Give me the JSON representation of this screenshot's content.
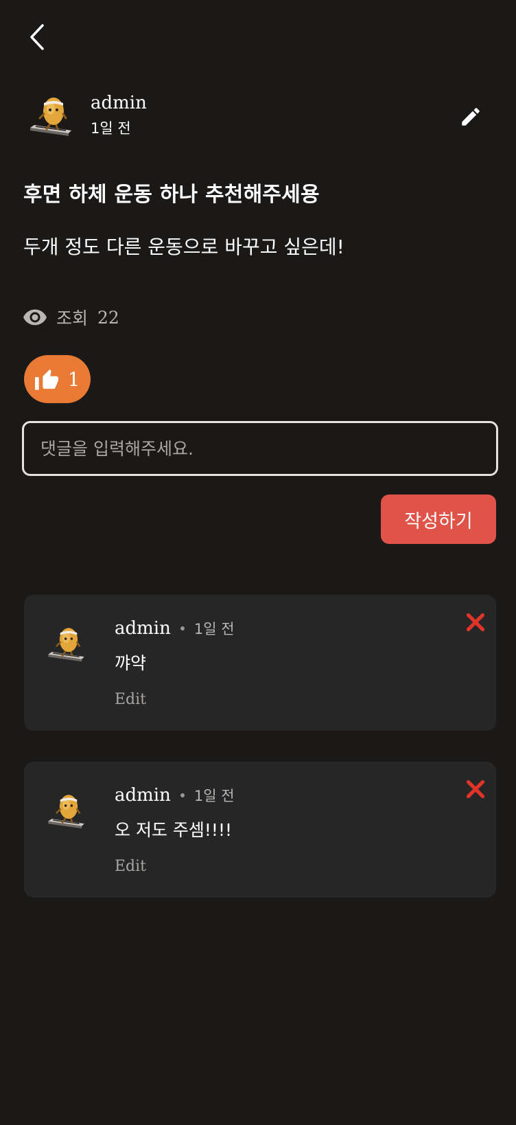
{
  "post": {
    "author": "admin",
    "time": "1일 전",
    "title": "후면 하체 운동 하나 추천해주세용",
    "body": "두개 정도 다른 운동으로 바꾸고 싶은데!",
    "views_label": "조회",
    "views_count": "22",
    "likes": "1"
  },
  "comment_form": {
    "placeholder": "댓글을 입력해주세요.",
    "submit_label": "작성하기"
  },
  "comments": [
    {
      "author": "admin",
      "time": "1일 전",
      "text": "꺄약",
      "edit_label": "Edit"
    },
    {
      "author": "admin",
      "time": "1일 전",
      "text": "오 저도 주셈!!!!",
      "edit_label": "Edit"
    }
  ],
  "icons": {
    "back": "chevron-left-icon",
    "edit": "pencil-icon",
    "views": "eye-icon",
    "like": "thumbs-up-icon",
    "delete": "close-icon",
    "avatar": "egg-character-avatar"
  },
  "colors": {
    "background": "#1a1918",
    "card": "#262626",
    "like_button": "#e87a35",
    "submit_button": "#df5349",
    "delete_icon": "#e0342a"
  }
}
